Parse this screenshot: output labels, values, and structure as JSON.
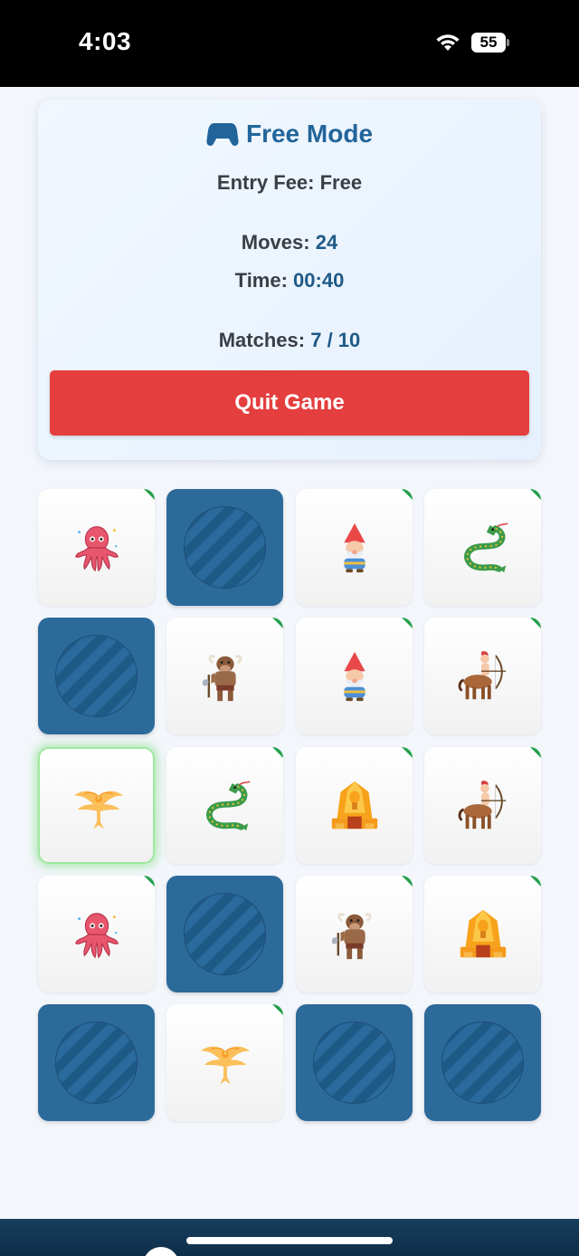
{
  "status_bar": {
    "time": "4:03",
    "battery": "55"
  },
  "game": {
    "title": "Free Mode",
    "entry_fee_label": "Entry Fee: Free",
    "moves": {
      "label": "Moves: ",
      "value": "24"
    },
    "time": {
      "label": "Time: ",
      "value": "00:40"
    },
    "matches": {
      "label": "Matches: ",
      "value": "7 / 10"
    },
    "quit_label": "Quit Game"
  },
  "board": {
    "rows": 5,
    "cols": 4,
    "tiles": [
      {
        "state": "revealed",
        "icon": "octopus-icon",
        "matched": true
      },
      {
        "state": "hidden"
      },
      {
        "state": "revealed",
        "icon": "gnome-icon",
        "matched": true
      },
      {
        "state": "revealed",
        "icon": "dragon-icon",
        "matched": true
      },
      {
        "state": "hidden"
      },
      {
        "state": "revealed",
        "icon": "minotaur-icon",
        "matched": true
      },
      {
        "state": "revealed",
        "icon": "gnome-icon",
        "matched": true
      },
      {
        "state": "revealed",
        "icon": "centaur-icon",
        "matched": true
      },
      {
        "state": "revealed",
        "icon": "phoenix-icon",
        "matched": false,
        "selected": true
      },
      {
        "state": "revealed",
        "icon": "dragon-icon",
        "matched": true
      },
      {
        "state": "revealed",
        "icon": "sphinx-icon",
        "matched": true
      },
      {
        "state": "revealed",
        "icon": "centaur-icon",
        "matched": true
      },
      {
        "state": "revealed",
        "icon": "octopus-icon",
        "matched": true
      },
      {
        "state": "hidden"
      },
      {
        "state": "revealed",
        "icon": "minotaur-icon",
        "matched": true
      },
      {
        "state": "revealed",
        "icon": "sphinx-icon",
        "matched": true
      },
      {
        "state": "hidden"
      },
      {
        "state": "revealed",
        "icon": "phoenix-icon",
        "matched": true
      },
      {
        "state": "hidden"
      },
      {
        "state": "hidden"
      }
    ]
  },
  "colors": {
    "accent": "#22659a",
    "quit": "#e53e3e",
    "tile_back": "#2c6a9a",
    "match_marker": "#22a04b"
  }
}
